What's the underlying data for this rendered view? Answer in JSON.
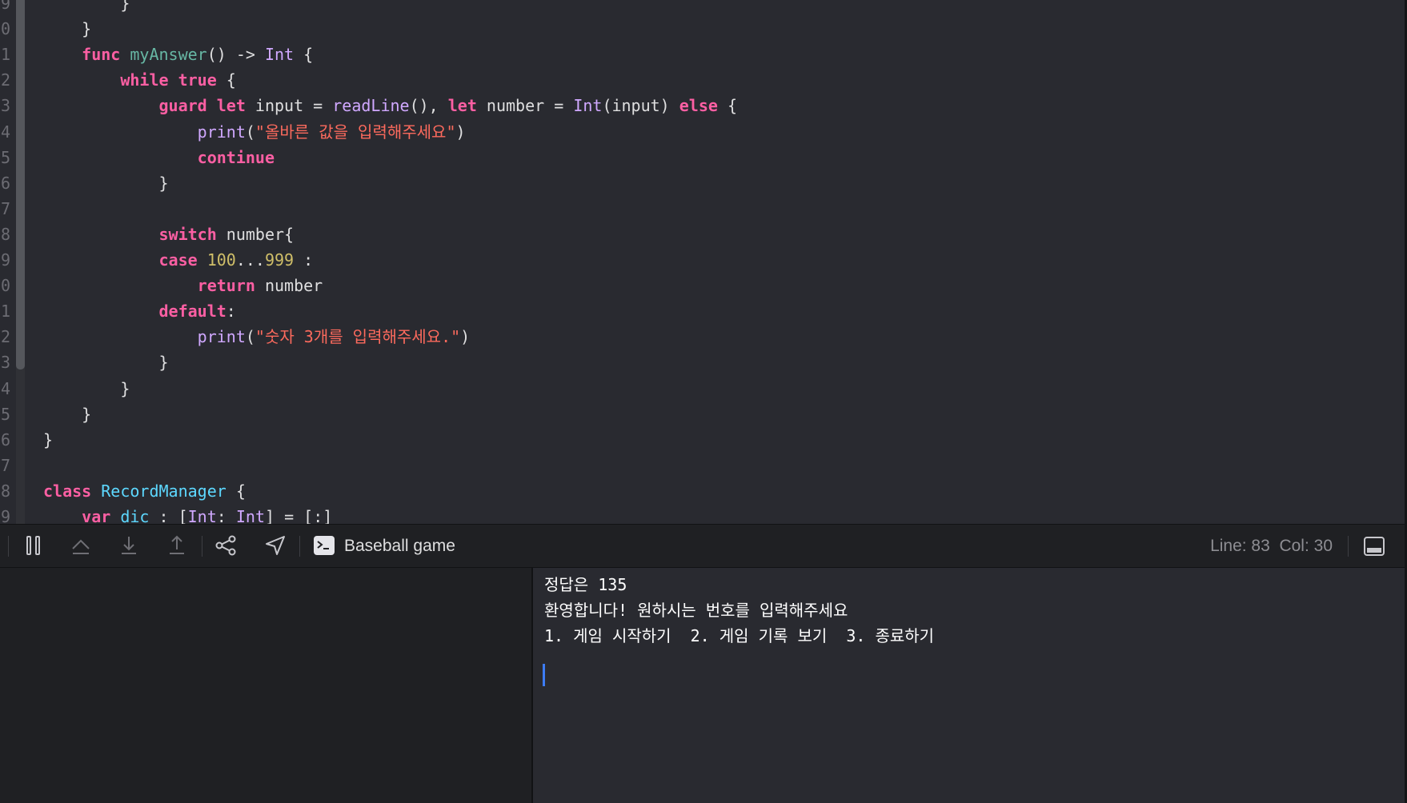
{
  "editor": {
    "line_numbers": [
      "9",
      "0",
      "1",
      "2",
      "3",
      "4",
      "5",
      "6",
      "7",
      "8",
      "9",
      "0",
      "1",
      "2",
      "3",
      "4",
      "5",
      "6",
      "7",
      "8",
      "9"
    ],
    "lines": [
      [
        {
          "t": "        }",
          "c": "pl"
        }
      ],
      [
        {
          "t": "    }",
          "c": "pl"
        }
      ],
      [
        {
          "t": "    ",
          "c": "pl"
        },
        {
          "t": "func",
          "c": "kw"
        },
        {
          "t": " ",
          "c": "pl"
        },
        {
          "t": "myAnswer",
          "c": "fn"
        },
        {
          "t": "() -> ",
          "c": "pl"
        },
        {
          "t": "Int",
          "c": "ty"
        },
        {
          "t": " {",
          "c": "pl"
        }
      ],
      [
        {
          "t": "        ",
          "c": "pl"
        },
        {
          "t": "while",
          "c": "kw"
        },
        {
          "t": " ",
          "c": "pl"
        },
        {
          "t": "true",
          "c": "kw"
        },
        {
          "t": " {",
          "c": "pl"
        }
      ],
      [
        {
          "t": "            ",
          "c": "pl"
        },
        {
          "t": "guard",
          "c": "kw"
        },
        {
          "t": " ",
          "c": "pl"
        },
        {
          "t": "let",
          "c": "kw"
        },
        {
          "t": " input = ",
          "c": "pl"
        },
        {
          "t": "readLine",
          "c": "ty"
        },
        {
          "t": "(), ",
          "c": "pl"
        },
        {
          "t": "let",
          "c": "kw"
        },
        {
          "t": " number = ",
          "c": "pl"
        },
        {
          "t": "Int",
          "c": "ty"
        },
        {
          "t": "(input) ",
          "c": "pl"
        },
        {
          "t": "else",
          "c": "kw"
        },
        {
          "t": " {",
          "c": "pl"
        }
      ],
      [
        {
          "t": "                ",
          "c": "pl"
        },
        {
          "t": "print",
          "c": "ty"
        },
        {
          "t": "(",
          "c": "pl"
        },
        {
          "t": "\"올바른 값을 입력해주세요\"",
          "c": "st"
        },
        {
          "t": ")",
          "c": "pl"
        }
      ],
      [
        {
          "t": "                ",
          "c": "pl"
        },
        {
          "t": "continue",
          "c": "kw"
        }
      ],
      [
        {
          "t": "            }",
          "c": "pl"
        }
      ],
      [
        {
          "t": "",
          "c": "pl"
        }
      ],
      [
        {
          "t": "            ",
          "c": "pl"
        },
        {
          "t": "switch",
          "c": "kw"
        },
        {
          "t": " number{",
          "c": "pl"
        }
      ],
      [
        {
          "t": "            ",
          "c": "pl"
        },
        {
          "t": "case",
          "c": "kw"
        },
        {
          "t": " ",
          "c": "pl"
        },
        {
          "t": "100",
          "c": "nm"
        },
        {
          "t": "...",
          "c": "pl"
        },
        {
          "t": "999",
          "c": "nm"
        },
        {
          "t": " :",
          "c": "pl"
        }
      ],
      [
        {
          "t": "                ",
          "c": "pl"
        },
        {
          "t": "return",
          "c": "kw"
        },
        {
          "t": " number",
          "c": "pl"
        }
      ],
      [
        {
          "t": "            ",
          "c": "pl"
        },
        {
          "t": "default",
          "c": "kw"
        },
        {
          "t": ":",
          "c": "pl"
        }
      ],
      [
        {
          "t": "                ",
          "c": "pl"
        },
        {
          "t": "print",
          "c": "ty"
        },
        {
          "t": "(",
          "c": "pl"
        },
        {
          "t": "\"숫자 3개를 입력해주세요.\"",
          "c": "st"
        },
        {
          "t": ")",
          "c": "pl"
        }
      ],
      [
        {
          "t": "            }",
          "c": "pl"
        }
      ],
      [
        {
          "t": "        }",
          "c": "pl"
        }
      ],
      [
        {
          "t": "    }",
          "c": "pl"
        }
      ],
      [
        {
          "t": "}",
          "c": "pl"
        }
      ],
      [
        {
          "t": "",
          "c": "pl"
        }
      ],
      [
        {
          "t": "class",
          "c": "kw"
        },
        {
          "t": " ",
          "c": "pl"
        },
        {
          "t": "RecordManager",
          "c": "dc"
        },
        {
          "t": " {",
          "c": "pl"
        }
      ],
      [
        {
          "t": "    ",
          "c": "pl"
        },
        {
          "t": "var",
          "c": "kw"
        },
        {
          "t": " ",
          "c": "pl"
        },
        {
          "t": "dic",
          "c": "dc"
        },
        {
          "t": " : [",
          "c": "pl"
        },
        {
          "t": "Int",
          "c": "ty"
        },
        {
          "t": ": ",
          "c": "pl"
        },
        {
          "t": "Int",
          "c": "ty"
        },
        {
          "t": "] = [:]",
          "c": "pl"
        }
      ]
    ]
  },
  "debug_bar": {
    "icons": [
      "pause-icon",
      "step-over-icon",
      "step-into-icon",
      "step-out-icon",
      "memory-graph-icon",
      "location-icon"
    ],
    "target_name": "Baseball game",
    "line_col": "Line: 83  Col: 30"
  },
  "console": {
    "lines": [
      "정답은 135",
      "환영합니다! 원하시는 번호를 입력해주세요",
      "1. 게임 시작하기  2. 게임 기록 보기  3. 종료하기"
    ]
  },
  "colors": {
    "keyword": "#fc5fa3",
    "type": "#d0a8ff",
    "string": "#fc6a5d",
    "number": "#d0bf69",
    "declaration": "#5dd8ff",
    "function_decl": "#67b7a4",
    "plain": "#dfdfe0",
    "cursor": "#3d7cf5"
  }
}
